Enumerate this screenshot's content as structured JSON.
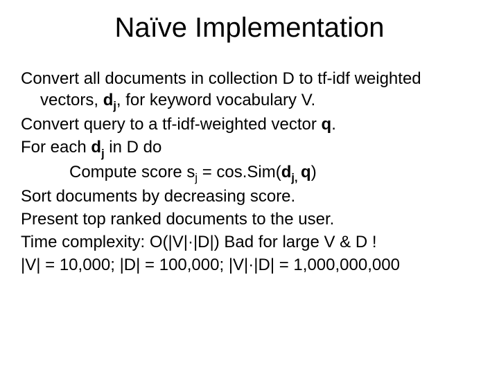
{
  "title": "Naïve Implementation",
  "lines": {
    "l1a": "Convert all documents in collection D to tf-idf",
    "l1b_pre": "weighted vectors, ",
    "l1b_dj_d": "d",
    "l1b_dj_j": "j",
    "l1b_post": ", for keyword vocabulary V.",
    "l2_pre": "Convert query to a tf-idf-weighted vector ",
    "l2_q": "q",
    "l2_post": ".",
    "l3_pre": "For each ",
    "l3_d": "d",
    "l3_j": "j",
    "l3_post": " in D do",
    "l4_pre": "Compute score s",
    "l4_j": "j",
    "l4_mid": " = cos.Sim(",
    "l4_d": "d",
    "l4_j2": "j, ",
    "l4_q": "q",
    "l4_post": ")",
    "l5": "Sort documents by decreasing score.",
    "l6": "Present top ranked documents to the user.",
    "l7": "Time complexity:  O(|V|·|D|)   Bad for large V & D !",
    "l8": "|V| = 10,000; |D| = 100,000; |V|·|D| = 1,000,000,000"
  }
}
